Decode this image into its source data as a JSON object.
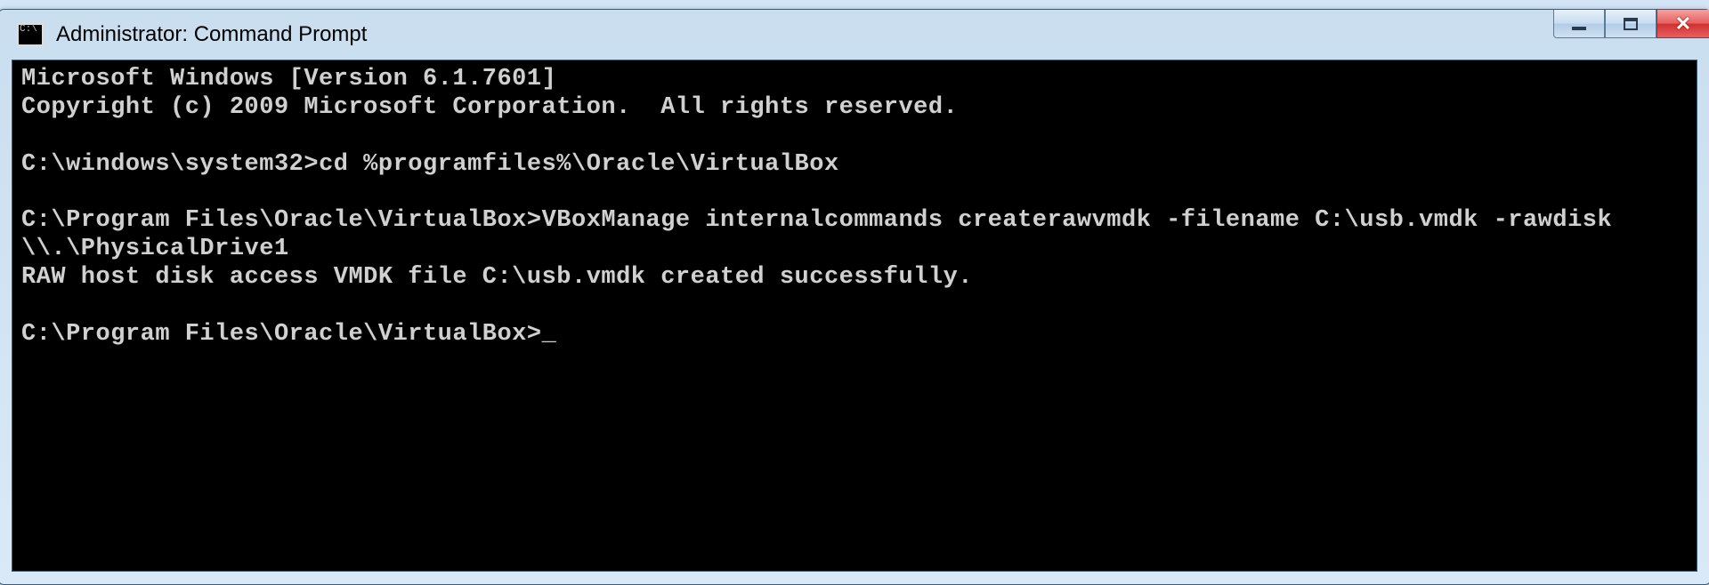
{
  "window": {
    "title": "Administrator: Command Prompt"
  },
  "terminal": {
    "line1": "Microsoft Windows [Version 6.1.7601]",
    "line2": "Copyright (c) 2009 Microsoft Corporation.  All rights reserved.",
    "blank1": "",
    "prompt1_path": "C:\\windows\\system32>",
    "cmd1": "cd %programfiles%\\Oracle\\VirtualBox",
    "blank2": "",
    "prompt2_path": "C:\\Program Files\\Oracle\\VirtualBox>",
    "cmd2": "VBoxManage internalcommands createrawvmdk -filename C:\\usb.vmdk -rawdisk \\\\.\\PhysicalDrive1",
    "output1": "RAW host disk access VMDK file C:\\usb.vmdk created successfully.",
    "blank3": "",
    "prompt3_path": "C:\\Program Files\\Oracle\\VirtualBox>",
    "cursor": "_"
  }
}
